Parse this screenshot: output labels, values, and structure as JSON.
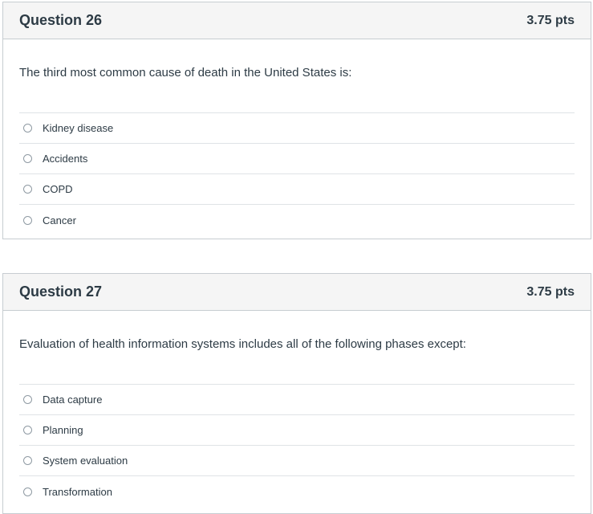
{
  "questions": [
    {
      "title": "Question 26",
      "points": "3.75 pts",
      "text": "The third most common cause of death in the United States is:",
      "answers": [
        "Kidney disease",
        "Accidents",
        "COPD",
        "Cancer"
      ]
    },
    {
      "title": "Question 27",
      "points": "3.75 pts",
      "text": "Evaluation of health information systems includes all of the following phases except:",
      "answers": [
        "Data capture",
        "Planning",
        "System evaluation",
        "Transformation"
      ]
    }
  ]
}
